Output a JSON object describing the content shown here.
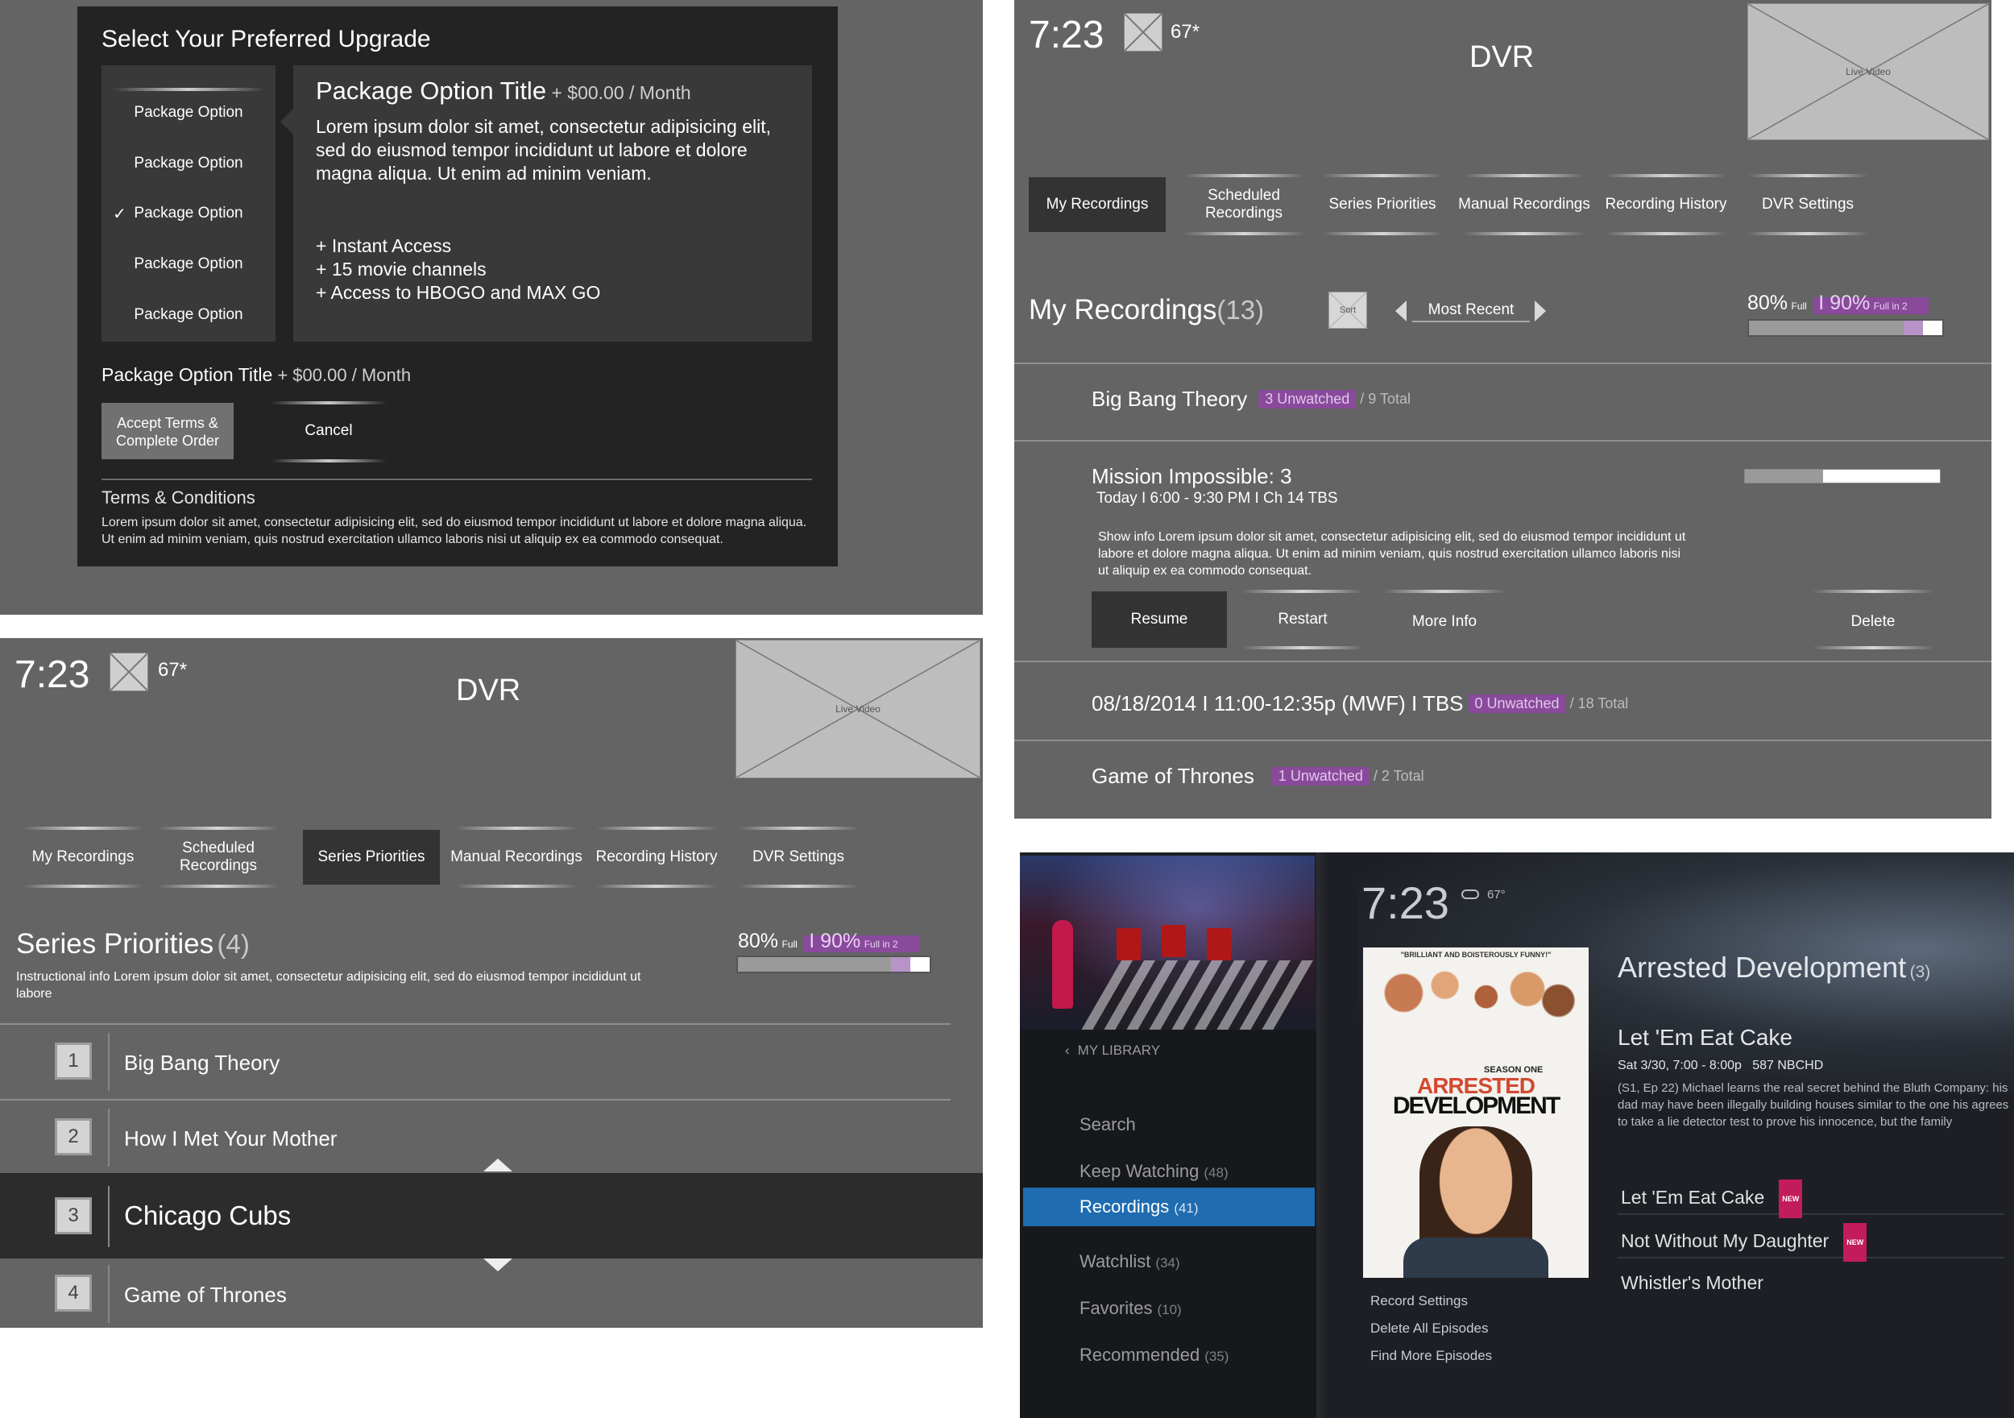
{
  "upgrade": {
    "title": "Select Your Preferred Upgrade",
    "options": [
      {
        "label": "Package Option",
        "checked": false
      },
      {
        "label": "Package Option",
        "checked": false
      },
      {
        "label": "Package Option",
        "checked": true
      },
      {
        "label": "Package Option",
        "checked": false
      },
      {
        "label": "Package Option",
        "checked": false
      }
    ],
    "check_mark": "✓",
    "detail_title": "Package Option Title",
    "detail_price": " + $00.00 / Month",
    "detail_desc": "Lorem ipsum dolor sit amet, consectetur adipisicing elit, sed do eiusmod tempor incididunt ut labore et dolore magna aliqua. Ut enim ad minim veniam.",
    "features": [
      "+ Instant Access",
      "+ 15 movie channels",
      "+ Access to HBOGO and MAX GO"
    ],
    "summary_title": "Package Option Title",
    "summary_price": " + $00.00 / Month",
    "accept_label": "Accept Terms & Complete Order",
    "cancel_label": "Cancel",
    "terms_title": "Terms & Conditions",
    "terms_text": "Lorem ipsum dolor sit amet, consectetur adipisicing elit, sed do eiusmod tempor incididunt ut labore et dolore magna aliqua. Ut enim ad minim veniam, quis nostrud exercitation ullamco laboris nisi ut aliquip ex ea commodo consequat."
  },
  "dvr_recordings": {
    "time": "7:23",
    "temp": "67*",
    "title": "DVR",
    "live_video": "Live Video",
    "tabs": [
      "My Recordings",
      "Scheduled Recordings",
      "Series Priorities",
      "Manual Recordings",
      "Recording History",
      "DVR Settings"
    ],
    "selected_tab": 0,
    "heading": "My Recordings",
    "count": "(13)",
    "sort_label": "Sort",
    "sort_value": "Most Recent",
    "storage_full": "80%",
    "storage_full_label": "Full",
    "storage_future": "I 90%",
    "storage_future_label": "Full in 2",
    "storage_used_fraction": 0.8,
    "storage_future_fraction": 0.9,
    "rows": [
      {
        "title": "Big Bang Theory",
        "unwatched": "3 Unwatched",
        "total": " / 9 Total"
      },
      {
        "title": "08/18/2014 I 11:00-12:35p (MWF) I TBS",
        "unwatched": "0 Unwatched",
        "total": " / 18 Total"
      },
      {
        "title": "Game of Thrones",
        "unwatched": "1 Unwatched",
        "total": " / 2 Total"
      }
    ],
    "expanded": {
      "title": "Mission Impossible: 3",
      "schedule": "Today I 6:00 - 9:30 PM I Ch 14 TBS",
      "info": "Show info Lorem ipsum dolor sit amet, consectetur adipisicing elit, sed do eiusmod tempor incididunt ut labore et dolore magna aliqua. Ut enim ad minim veniam, quis nostrud exercitation ullamco laboris nisi ut aliquip ex ea commodo consequat.",
      "progress_fraction": 0.4,
      "actions": [
        "Resume",
        "Restart",
        "More Info",
        "Delete"
      ]
    }
  },
  "dvr_priorities": {
    "time": "7:23",
    "temp": "67*",
    "title": "DVR",
    "live_video": "Live Video",
    "tabs": [
      "My Recordings",
      "Scheduled Recordings",
      "Series Priorities",
      "Manual Recordings",
      "Recording History",
      "DVR Settings"
    ],
    "selected_tab": 2,
    "heading": "Series Priorities",
    "count": "(4)",
    "instructions": "Instructional info Lorem ipsum dolor sit amet, consectetur adipisicing elit, sed do eiusmod tempor incididunt ut labore",
    "storage_full": "80%",
    "storage_full_label": "Full",
    "storage_future": "I 90%",
    "storage_future_label": "Full in 2",
    "storage_used_fraction": 0.8,
    "storage_future_fraction": 0.9,
    "items": [
      {
        "rank": "1",
        "title": "Big Bang Theory"
      },
      {
        "rank": "2",
        "title": "How I Met Your Mother"
      },
      {
        "rank": "3",
        "title": "Chicago Cubs"
      },
      {
        "rank": "4",
        "title": "Game of Thrones"
      }
    ],
    "selected_index": 2
  },
  "library": {
    "time": "7:23",
    "temp": "67°",
    "back_label": "MY LIBRARY",
    "menu": [
      {
        "label": "Search",
        "count": ""
      },
      {
        "label": "Keep Watching",
        "count": "(48)"
      },
      {
        "label": "Recordings",
        "count": "(41)"
      },
      {
        "label": "Watchlist",
        "count": "(34)"
      },
      {
        "label": "Favorites",
        "count": "(10)"
      },
      {
        "label": "Recommended",
        "count": "(35)"
      }
    ],
    "selected_menu": 2,
    "poster_quote": "\"BRILLIANT AND BOISTEROUSLY FUNNY!\"",
    "poster_season": "SEASON ONE",
    "poster_title_1": "ARRESTED",
    "poster_title_2": "DEVELOPMENT",
    "show_title": "Arrested Development",
    "show_count": "(3)",
    "episode_title": "Let 'Em Eat Cake",
    "episode_meta": "Sat 3/30, 7:00 - 8:00p   587 NBCHD",
    "episode_desc": "(S1, Ep 22) Michael learns the real secret behind the Bluth Company: his dad may have been illegally building houses similar to the one his agrees to take a lie detector test to prove his innocence, but the family",
    "actions": [
      "Record Settings",
      "Delete All Episodes",
      "Find More Episodes"
    ],
    "episodes": [
      {
        "title": "Let 'Em Eat Cake",
        "badge": "NEW"
      },
      {
        "title": "Not Without My Daughter",
        "badge": "NEW"
      },
      {
        "title": "Whistler's Mother",
        "badge": ""
      }
    ],
    "accent_color": "#1f6cb0"
  }
}
